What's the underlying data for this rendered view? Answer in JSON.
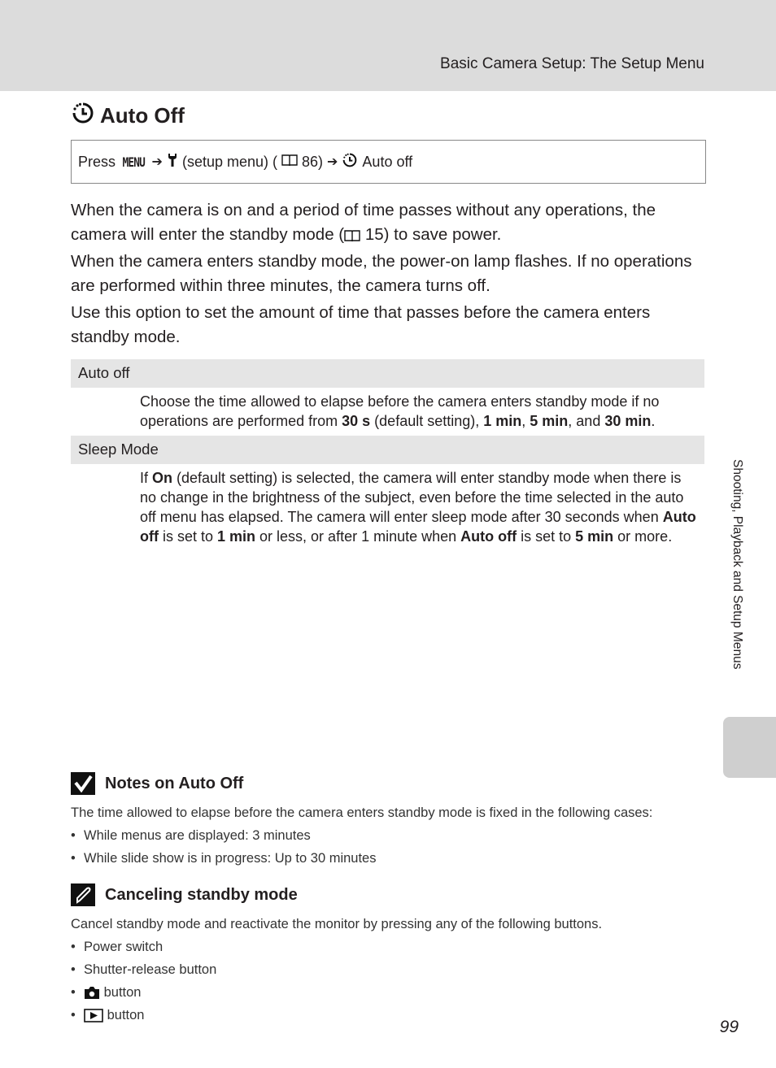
{
  "header": {
    "title": "Basic Camera Setup: The Setup Menu"
  },
  "page_title": {
    "icon": "auto-off-timer-icon",
    "text": "Auto Off"
  },
  "press_path": {
    "press": "Press",
    "menu": "MENU",
    "setup": "(setup menu) (",
    "ref": "86)",
    "target": "Auto off"
  },
  "intro": [
    "When the camera is on and a period of time passes without any operations, the camera will enter the standby mode (",
    "15) to save power.",
    "When the camera enters standby mode, the power-on lamp flashes. If no operations are performed within three minutes, the camera turns off.",
    "Use this option to set the amount of time that passes before the camera enters standby mode."
  ],
  "options": [
    {
      "label": "Auto off",
      "parts": [
        "Choose the time allowed to elapse before the camera enters standby mode if no operations are performed from ",
        "30 s",
        " (default setting), ",
        "1 min",
        ", ",
        "5 min",
        ", and ",
        "30 min",
        "."
      ]
    },
    {
      "label": "Sleep Mode",
      "parts": [
        "If ",
        "On",
        " (default setting) is selected, the camera will enter standby mode when there is no change in the brightness of the subject, even before the time selected in the auto off menu has elapsed. The camera will enter sleep mode after 30 seconds when ",
        "Auto off",
        " is set to ",
        "1 min",
        " or less, or after 1 minute when ",
        "Auto off",
        " is set to ",
        "5 min",
        " or more."
      ]
    }
  ],
  "notes": {
    "title": "Notes on Auto Off",
    "text": "The time allowed to elapse before the camera enters standby mode is fixed in the following cases:",
    "items": [
      "While menus are displayed: 3 minutes",
      "While slide show is in progress: Up to 30 minutes"
    ]
  },
  "cancel": {
    "title": "Canceling standby mode",
    "text": "Cancel standby mode and reactivate the monitor by pressing any of the following buttons.",
    "items": [
      "Power switch",
      "Shutter-release button"
    ],
    "button_label": "button"
  },
  "side_tab": "Shooting, Playback and Setup Menus",
  "page_number": "99"
}
